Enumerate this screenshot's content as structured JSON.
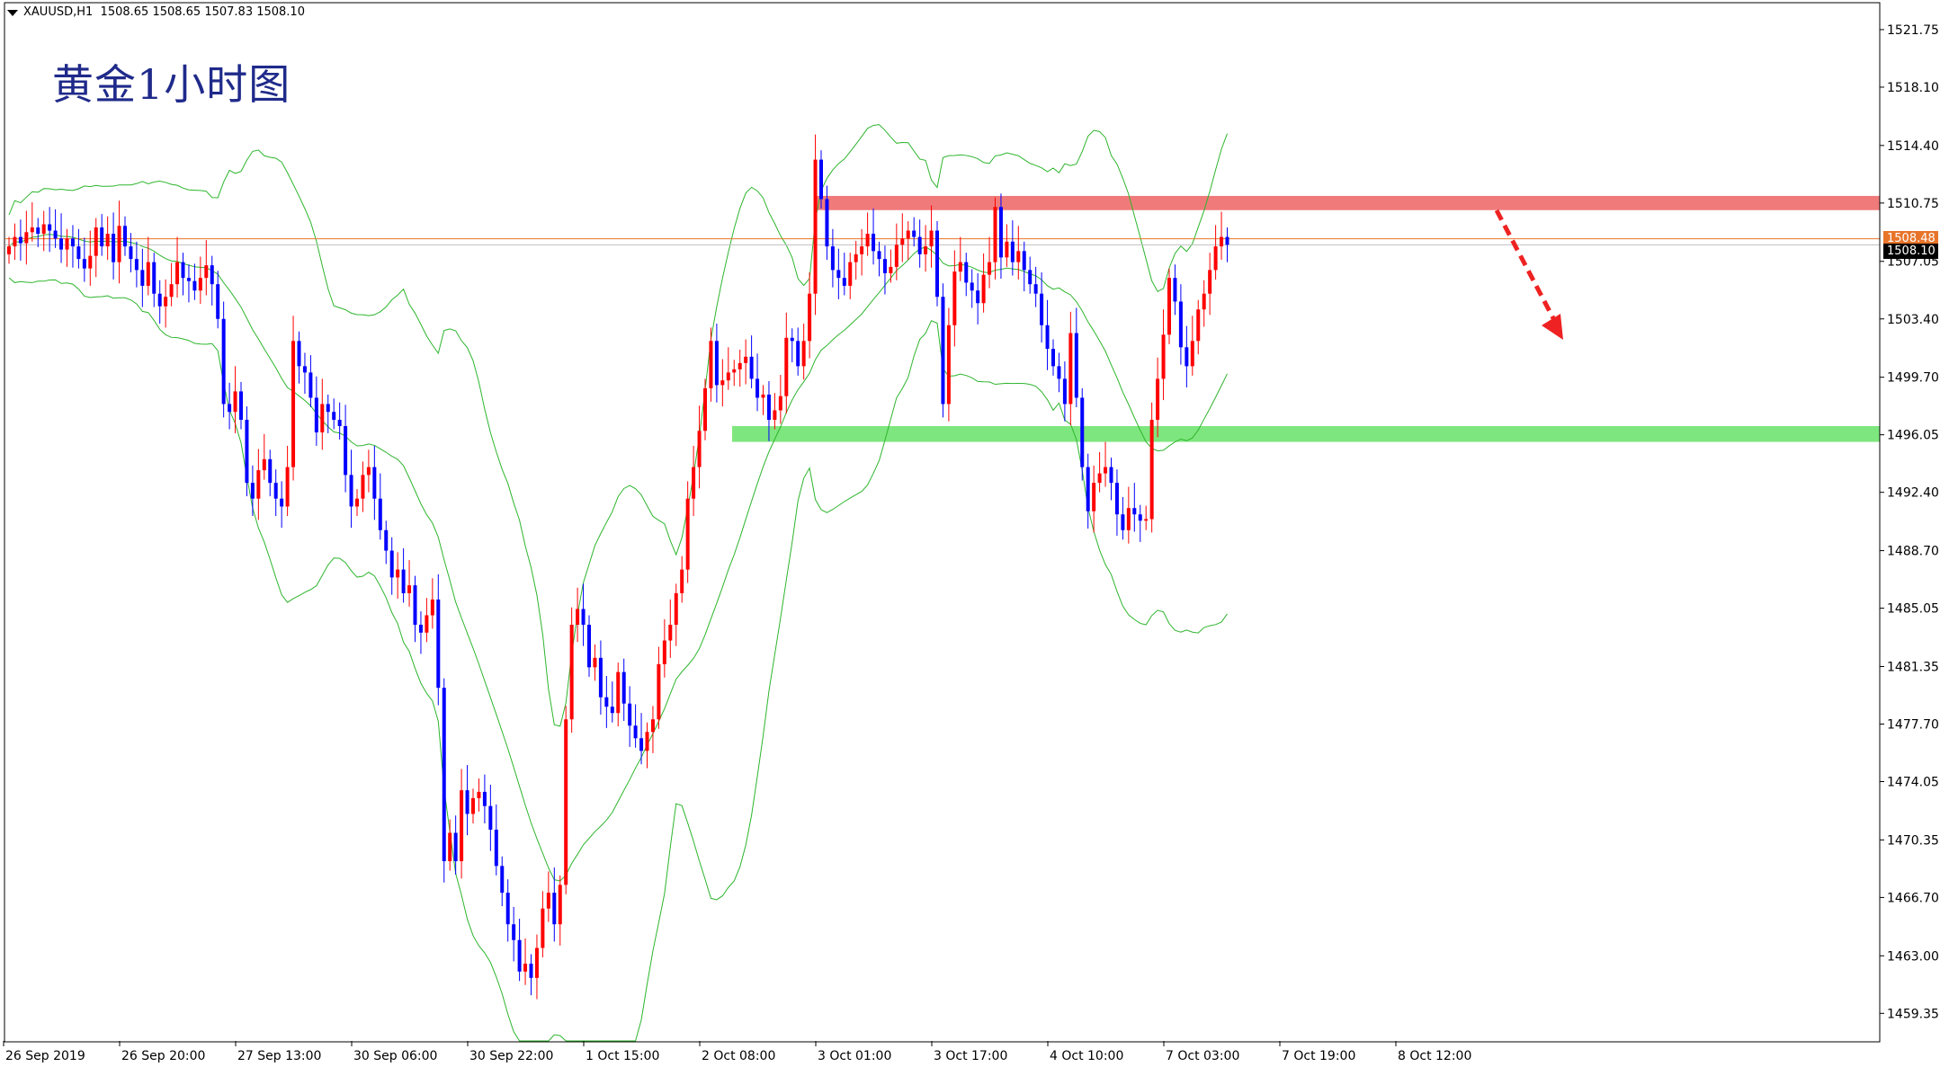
{
  "header": {
    "symbol": "XAUUSD,H1",
    "ohlc": "1508.65 1508.65 1507.83 1508.10"
  },
  "title": "黄金1小时图",
  "current_price_label": "1508.10",
  "bid_label": "1508.48",
  "colors": {
    "bull": "#ff0000",
    "bear": "#0000ff",
    "bollinger": "#2db52d",
    "resistance_zone": "#f07a7a",
    "support_zone": "#7ee67e",
    "price_line": "#e8742a",
    "arrow": "#ee2222",
    "grid_frame": "#000000",
    "title": "#1f2a8a"
  },
  "chart_data": {
    "type": "candlestick",
    "ylim": [
      1457.6,
      1523.4
    ],
    "yticks": [
      "1521.75",
      "1518.10",
      "1514.40",
      "1510.75",
      "1507.05",
      "1503.40",
      "1499.70",
      "1496.05",
      "1492.40",
      "1488.70",
      "1485.05",
      "1481.35",
      "1477.70",
      "1474.05",
      "1470.35",
      "1466.70",
      "1463.00",
      "1459.35"
    ],
    "xticks": [
      {
        "label": "26 Sep 2019",
        "bar": 0
      },
      {
        "label": "26 Sep 20:00",
        "bar": 20
      },
      {
        "label": "27 Sep 13:00",
        "bar": 40
      },
      {
        "label": "30 Sep 06:00",
        "bar": 60
      },
      {
        "label": "30 Sep 22:00",
        "bar": 80
      },
      {
        "label": "1 Oct 15:00",
        "bar": 100
      },
      {
        "label": "2 Oct 08:00",
        "bar": 120
      },
      {
        "label": "3 Oct 01:00",
        "bar": 140
      },
      {
        "label": "3 Oct 17:00",
        "bar": 160
      },
      {
        "label": "4 Oct 10:00",
        "bar": 180
      },
      {
        "label": "7 Oct 03:00",
        "bar": 200
      },
      {
        "label": "7 Oct 19:00",
        "bar": 220
      },
      {
        "label": "8 Oct 12:00",
        "bar": 240
      }
    ],
    "bar_count_visible": 326,
    "closes": [
      1508.0,
      1508.6,
      1508.2,
      1508.9,
      1509.2,
      1508.8,
      1509.4,
      1509.0,
      1508.5,
      1507.8,
      1508.5,
      1508.0,
      1507.2,
      1506.6,
      1507.4,
      1509.2,
      1508.0,
      1508.8,
      1507.0,
      1509.3,
      1508.0,
      1507.2,
      1506.5,
      1505.5,
      1507.0,
      1505.0,
      1504.2,
      1504.8,
      1505.6,
      1507.0,
      1506.0,
      1505.8,
      1505.2,
      1506.0,
      1506.8,
      1505.6,
      1503.4,
      1498.0,
      1497.5,
      1498.8,
      1497.0,
      1493.0,
      1492.0,
      1493.8,
      1494.5,
      1493.0,
      1492.0,
      1491.5,
      1494.0,
      1502.0,
      1500.4,
      1500.0,
      1498.4,
      1496.2,
      1498.0,
      1497.5,
      1497.0,
      1496.6,
      1493.5,
      1491.5,
      1492.0,
      1493.5,
      1494.0,
      1492.0,
      1490.0,
      1488.7,
      1487.0,
      1487.5,
      1486.0,
      1486.5,
      1484.0,
      1483.5,
      1484.6,
      1485.6,
      1480.0,
      1469.0,
      1470.8,
      1469.0,
      1473.5,
      1472.0,
      1473.0,
      1473.4,
      1472.5,
      1471.0,
      1468.7,
      1467.0,
      1465.0,
      1464.0,
      1462.0,
      1462.5,
      1461.6,
      1463.5,
      1466.0,
      1467.0,
      1465.0,
      1467.5,
      1478.0,
      1484.0,
      1485.0,
      1484.0,
      1481.3,
      1481.9,
      1479.4,
      1478.8,
      1478.4,
      1481.0,
      1479.0,
      1477.6,
      1476.8,
      1476.0,
      1477.2,
      1478.0,
      1481.5,
      1483.0,
      1484.0,
      1486.0,
      1487.5,
      1492.0,
      1494.0,
      1496.3,
      1499.0,
      1502.0,
      1499.2,
      1499.5,
      1500.0,
      1500.2,
      1500.6,
      1501.0,
      1499.6,
      1498.4,
      1498.6,
      1497.0,
      1497.6,
      1498.5,
      1502.2,
      1502.0,
      1500.4,
      1502.0,
      1505.0,
      1513.5,
      1511.0,
      1508.0,
      1506.5,
      1506.0,
      1505.5,
      1507.0,
      1507.5,
      1508.0,
      1508.8,
      1507.7,
      1507.2,
      1506.3,
      1506.7,
      1508.1,
      1508.5,
      1509.0,
      1508.6,
      1507.5,
      1508.0,
      1509.0,
      1504.8,
      1498.0,
      1503.0,
      1506.4,
      1507.0,
      1505.7,
      1505.2,
      1504.4,
      1506.2,
      1507.0,
      1510.5,
      1507.3,
      1508.3,
      1507.0,
      1507.7,
      1506.5,
      1505.6,
      1505.0,
      1503.0,
      1501.5,
      1500.4,
      1499.6,
      1498.0,
      1502.5,
      1498.4,
      1494.0,
      1491.2,
      1493.0,
      1493.6,
      1494.0,
      1493.0,
      1491.0,
      1490.0,
      1491.4,
      1491.0,
      1490.6,
      1490.7,
      1497.0,
      1499.6,
      1502.4,
      1506.0,
      1504.5,
      1501.6,
      1500.4,
      1502.0,
      1504.0,
      1505.0,
      1506.5,
      1508.0,
      1508.6,
      1508.1
    ],
    "opens": [
      1507.5,
      1508.0,
      1508.6,
      1508.2,
      1508.9,
      1509.2,
      1508.8,
      1509.4,
      1509.0,
      1508.5,
      1507.8,
      1508.5,
      1508.0,
      1507.2,
      1506.6,
      1507.4,
      1509.2,
      1508.0,
      1508.8,
      1507.0,
      1509.3,
      1508.0,
      1507.2,
      1506.5,
      1505.5,
      1507.0,
      1505.0,
      1504.2,
      1504.8,
      1505.6,
      1507.0,
      1506.0,
      1505.8,
      1505.2,
      1506.0,
      1506.8,
      1505.6,
      1503.4,
      1498.0,
      1497.5,
      1498.8,
      1497.0,
      1493.0,
      1492.0,
      1493.8,
      1494.5,
      1493.0,
      1492.0,
      1491.5,
      1494.0,
      1502.0,
      1500.4,
      1500.0,
      1498.4,
      1496.2,
      1498.0,
      1497.5,
      1497.0,
      1496.6,
      1493.5,
      1491.5,
      1492.0,
      1493.5,
      1494.0,
      1492.0,
      1490.0,
      1488.7,
      1487.0,
      1487.5,
      1486.0,
      1486.5,
      1484.0,
      1483.5,
      1484.6,
      1485.6,
      1480.0,
      1469.0,
      1470.8,
      1469.0,
      1473.5,
      1472.0,
      1473.0,
      1473.4,
      1472.5,
      1471.0,
      1468.7,
      1467.0,
      1465.0,
      1464.0,
      1462.0,
      1462.5,
      1461.6,
      1463.5,
      1466.0,
      1467.0,
      1465.0,
      1467.5,
      1478.0,
      1484.0,
      1485.0,
      1484.0,
      1481.3,
      1481.9,
      1479.4,
      1478.8,
      1478.4,
      1481.0,
      1479.0,
      1477.6,
      1476.8,
      1476.0,
      1477.2,
      1478.0,
      1481.5,
      1483.0,
      1484.0,
      1486.0,
      1487.5,
      1492.0,
      1494.0,
      1496.3,
      1499.0,
      1502.0,
      1499.2,
      1499.5,
      1500.0,
      1500.2,
      1500.6,
      1501.0,
      1499.6,
      1498.4,
      1498.6,
      1497.0,
      1497.6,
      1498.5,
      1502.2,
      1502.0,
      1500.4,
      1502.0,
      1505.0,
      1513.5,
      1511.0,
      1508.0,
      1506.5,
      1506.0,
      1505.5,
      1507.0,
      1507.5,
      1508.0,
      1508.8,
      1507.7,
      1507.2,
      1506.3,
      1506.7,
      1508.1,
      1508.5,
      1509.0,
      1508.6,
      1507.5,
      1508.0,
      1509.0,
      1504.8,
      1498.0,
      1503.0,
      1506.4,
      1507.0,
      1505.7,
      1505.2,
      1504.4,
      1506.2,
      1507.0,
      1510.5,
      1507.3,
      1508.3,
      1507.0,
      1507.7,
      1506.5,
      1505.6,
      1505.0,
      1503.0,
      1501.5,
      1500.4,
      1499.6,
      1498.0,
      1502.5,
      1498.4,
      1494.0,
      1491.2,
      1493.0,
      1493.6,
      1494.0,
      1493.0,
      1491.0,
      1490.0,
      1491.4,
      1491.0,
      1490.6,
      1490.7,
      1497.0,
      1499.6,
      1502.4,
      1506.0,
      1504.5,
      1501.6,
      1500.4,
      1502.0,
      1504.0,
      1505.0,
      1506.5,
      1508.0,
      1508.6
    ],
    "resistance_zone": [
      1510.3,
      1511.2
    ],
    "support_zone": [
      1495.6,
      1496.6
    ],
    "current_price": 1508.1,
    "bid_line": 1508.48
  }
}
